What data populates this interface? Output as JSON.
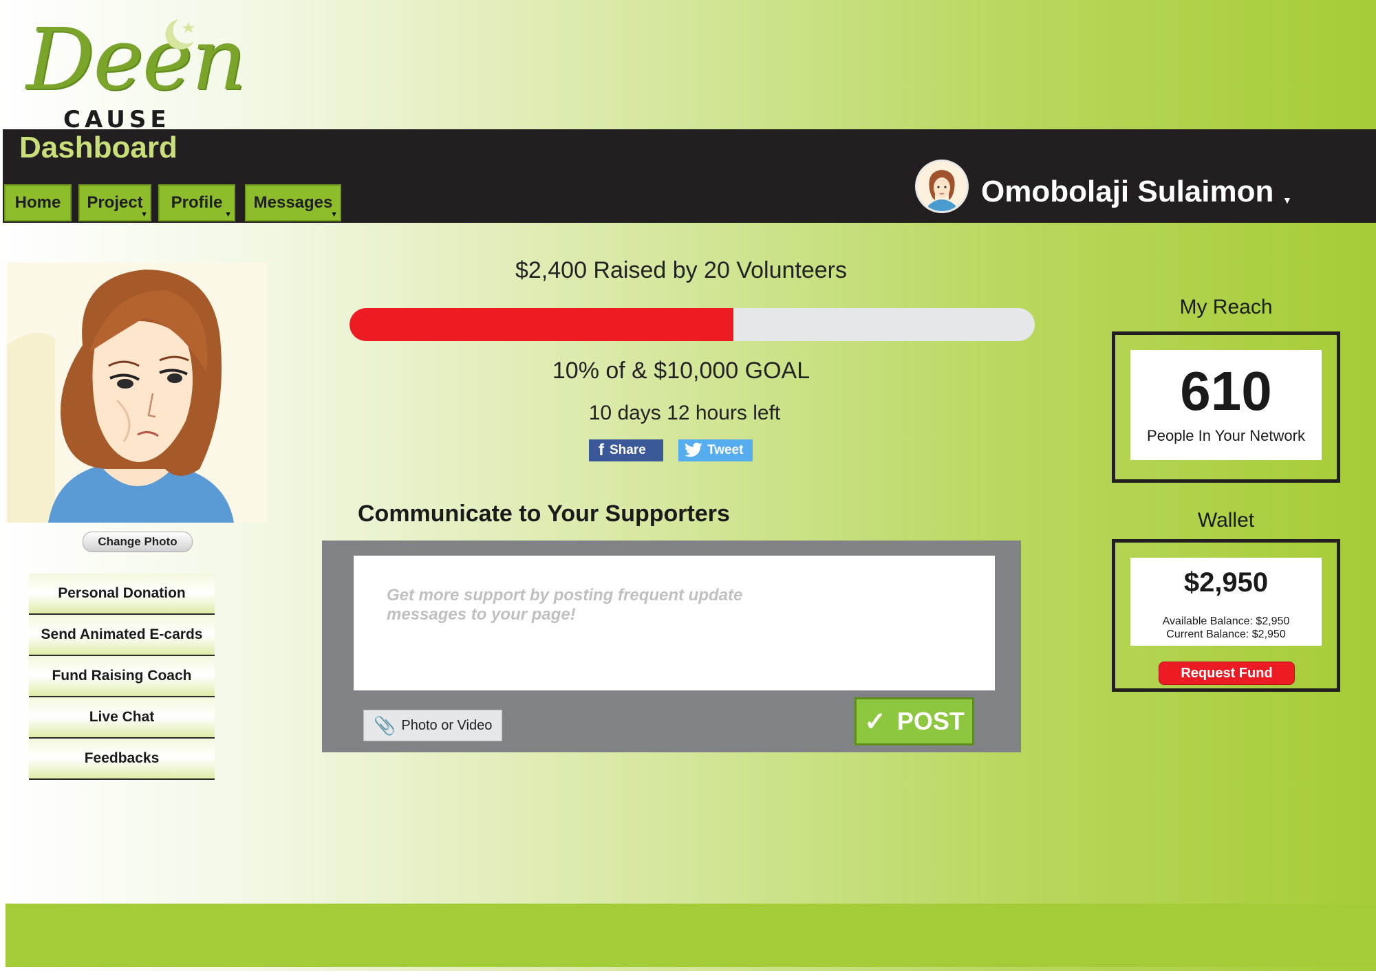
{
  "brand": {
    "logo_word": "Deen",
    "logo_sub": "CAUSE"
  },
  "header": {
    "title": "Dashboard",
    "user_name": "Omobolaji Sulaimon"
  },
  "nav": [
    {
      "label": "Home",
      "has_menu": false
    },
    {
      "label": "Project",
      "has_menu": true
    },
    {
      "label": "Profile",
      "has_menu": true
    },
    {
      "label": "Messages",
      "has_menu": true
    }
  ],
  "sidebar": {
    "change_photo": "Change Photo",
    "items": [
      {
        "label": "Personal Donation"
      },
      {
        "label": "Send Animated E-cards"
      },
      {
        "label": "Fund Raising Coach"
      },
      {
        "label": "Live Chat"
      },
      {
        "label": "Feedbacks"
      }
    ]
  },
  "campaign": {
    "raised_text": "$2,400 Raised by 20 Volunteers",
    "progress_fraction": 0.56,
    "goal_text": "10% of & $10,000 GOAL",
    "time_left": "10 days 12 hours left",
    "share_label": "Share",
    "tweet_label": "Tweet"
  },
  "composer": {
    "heading": "Communicate to Your Supporters",
    "placeholder": "Get more support by posting frequent update\nmessages to your page!",
    "attach_label": "Photo or Video",
    "post_label": "POST"
  },
  "reach": {
    "title": "My Reach",
    "number": "610",
    "label": "People In Your Network"
  },
  "wallet": {
    "title": "Wallet",
    "amount": "$2,950",
    "available": "Available Balance: $2,950",
    "current": "Current Balance: $2,950",
    "request_label": "Request Fund"
  },
  "colors": {
    "accent_green": "#8dbd2a",
    "header_dark": "#231f20",
    "progress_red": "#ed1c24",
    "footer_green": "#a4cc39"
  },
  "icons": {
    "share": "facebook-icon",
    "tweet": "twitter-icon",
    "attach": "paperclip-icon",
    "post": "checkmark-icon",
    "caret": "caret-down-icon"
  }
}
